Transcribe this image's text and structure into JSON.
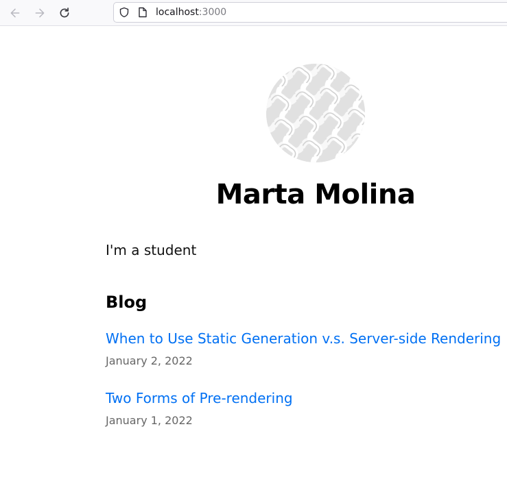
{
  "browser": {
    "url_host": "localhost",
    "url_port": ":3000",
    "back_icon": "arrow-left-icon",
    "forward_icon": "arrow-right-icon",
    "reload_icon": "reload-icon",
    "shield_icon": "shield-icon",
    "page_icon": "page-icon"
  },
  "profile": {
    "name": "Marta Molina",
    "bio": "I'm a student"
  },
  "blog": {
    "heading": "Blog",
    "posts": [
      {
        "title": "When to Use Static Generation v.s. Server-side Rendering",
        "date": "January 2, 2022"
      },
      {
        "title": "Two Forms of Pre-rendering",
        "date": "January 1, 2022"
      }
    ]
  },
  "colors": {
    "link": "#0070f3",
    "date": "#666666"
  }
}
